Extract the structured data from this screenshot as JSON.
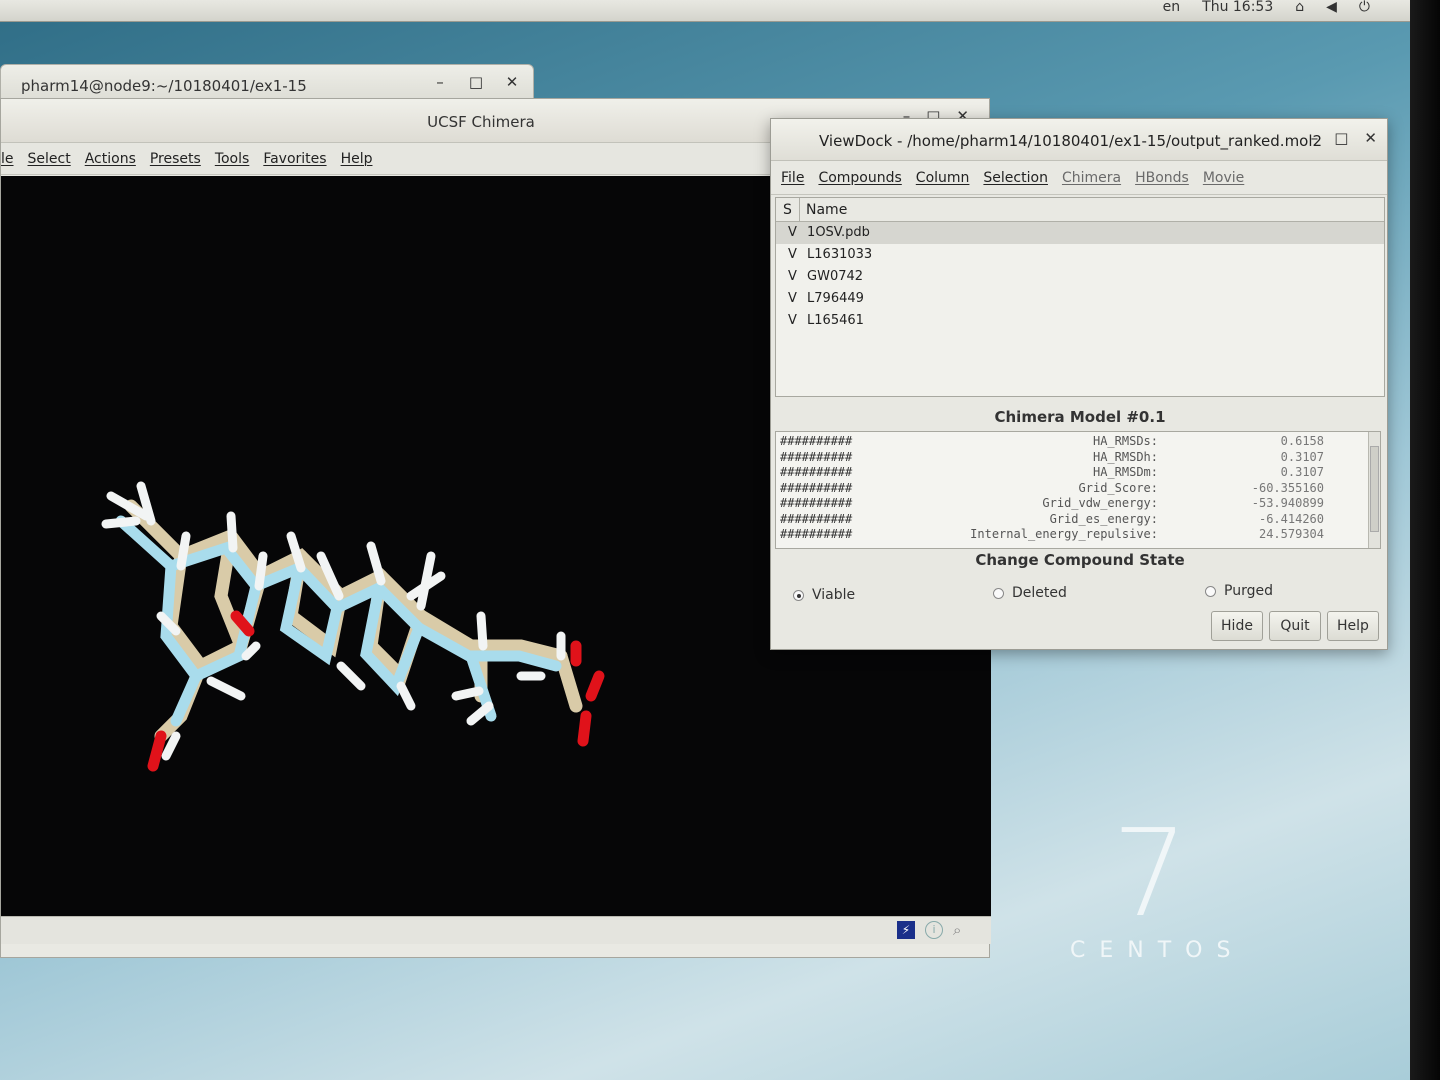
{
  "topbar": {
    "lang": "en",
    "clock": "Thu 16:53"
  },
  "terminal": {
    "title": "pharm14@node9:~/10180401/ex1-15"
  },
  "window_controls": {
    "minimize": "–",
    "maximize": "□",
    "close": "✕"
  },
  "chimera": {
    "title": "UCSF Chimera",
    "menu": [
      "le",
      "Select",
      "Actions",
      "Presets",
      "Tools",
      "Favorites",
      "Help"
    ]
  },
  "viewdock": {
    "title": "ViewDock - /home/pharm14/10180401/ex1-15/output_ranked.mol2",
    "menu": [
      "File",
      "Compounds",
      "Column",
      "Selection",
      "Chimera",
      "HBonds",
      "Movie"
    ],
    "columns": {
      "s": "S",
      "name": "Name"
    },
    "compounds": [
      {
        "state": "V",
        "name": "1OSV.pdb"
      },
      {
        "state": "V",
        "name": "L1631033"
      },
      {
        "state": "V",
        "name": "GW0742"
      },
      {
        "state": "V",
        "name": "L796449"
      },
      {
        "state": "V",
        "name": "L165461"
      }
    ],
    "model_header": "Chimera Model #0.1",
    "properties": [
      {
        "hash": "##########",
        "key": "HA_RMSDs:",
        "value": "0.6158"
      },
      {
        "hash": "##########",
        "key": "HA_RMSDh:",
        "value": "0.3107"
      },
      {
        "hash": "##########",
        "key": "HA_RMSDm:",
        "value": "0.3107"
      },
      {
        "hash": "##########",
        "key": "Grid_Score:",
        "value": "-60.355160"
      },
      {
        "hash": "##########",
        "key": "Grid_vdw_energy:",
        "value": "-53.940899"
      },
      {
        "hash": "##########",
        "key": "Grid_es_energy:",
        "value": "-6.414260"
      },
      {
        "hash": "##########",
        "key": "Internal_energy_repulsive:",
        "value": "24.579304"
      }
    ],
    "change_state_header": "Change Compound State",
    "states": {
      "viable": "Viable",
      "deleted": "Deleted",
      "purged": "Purged",
      "selected": "viable"
    },
    "buttons": {
      "hide": "Hide",
      "quit": "Quit",
      "help": "Help"
    }
  },
  "desktop": {
    "logo_number": "7",
    "logo_word": "CENTOS"
  }
}
